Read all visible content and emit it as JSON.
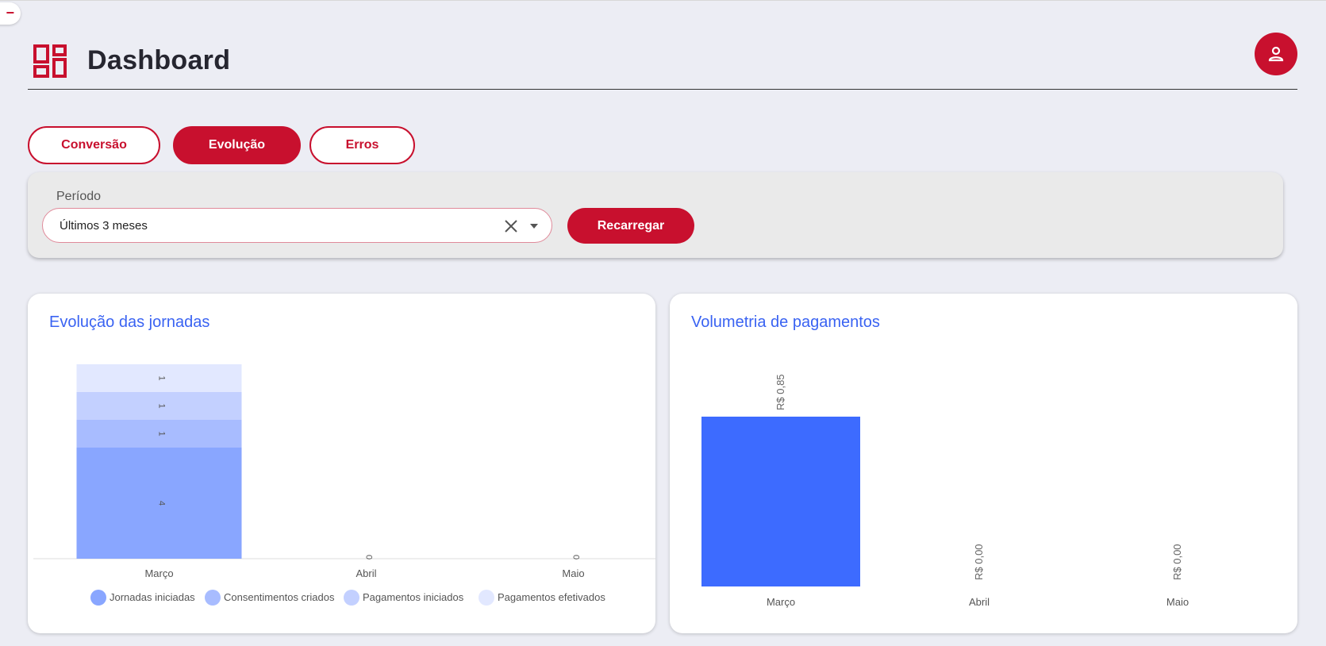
{
  "header": {
    "title": "Dashboard"
  },
  "tabs": [
    {
      "label": "Conversão",
      "active": false
    },
    {
      "label": "Evolução",
      "active": true
    },
    {
      "label": "Erros",
      "active": false
    }
  ],
  "filter": {
    "label": "Período",
    "value": "Últimos 3 meses",
    "reload_label": "Recarregar"
  },
  "colors": {
    "brand": "#c8102e",
    "title_blue": "#3a63f2",
    "bar_blue": "#3d6bff",
    "series": [
      "#89a6ff",
      "#a8bcff",
      "#c3d0ff",
      "#e2e8ff"
    ]
  },
  "icons": [
    "collapse-icon",
    "dashboard-icon",
    "user-icon",
    "clear-icon",
    "chevron-down-icon"
  ],
  "chart_data": [
    {
      "type": "bar",
      "stacked": true,
      "title": "Evolução das jornadas",
      "categories": [
        "Março",
        "Abril",
        "Maio"
      ],
      "series": [
        {
          "name": "Jornadas iniciadas",
          "values": [
            4,
            0,
            0
          ]
        },
        {
          "name": "Consentimentos criados",
          "values": [
            1,
            0,
            0
          ]
        },
        {
          "name": "Pagamentos iniciados",
          "values": [
            1,
            0,
            0
          ]
        },
        {
          "name": "Pagamentos efetivados",
          "values": [
            1,
            0,
            0
          ]
        }
      ],
      "total_labels": [
        "",
        "0",
        "0"
      ],
      "legend": "bottom"
    },
    {
      "type": "bar",
      "title": "Volumetria de pagamentos",
      "categories": [
        "Março",
        "Abril",
        "Maio"
      ],
      "values": [
        0.85,
        0,
        0
      ],
      "value_labels": [
        "R$ 0,85",
        "R$ 0,00",
        "R$ 0,00"
      ]
    }
  ]
}
